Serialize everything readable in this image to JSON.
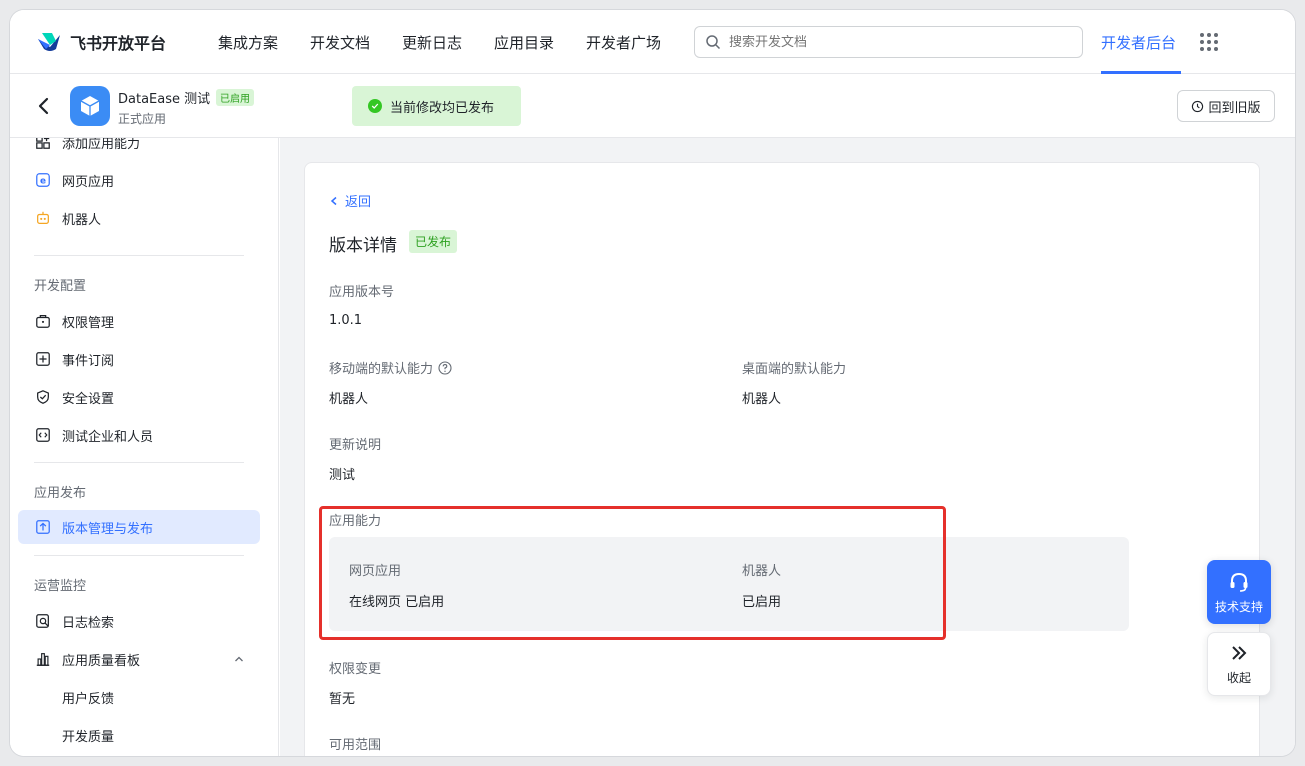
{
  "topnav": {
    "brand": "飞书开放平台",
    "links": [
      "集成方案",
      "开发文档",
      "更新日志",
      "应用目录",
      "开发者广场"
    ],
    "search_placeholder": "搜索开发文档",
    "console": "开发者后台"
  },
  "app": {
    "name": "DataEase 测试",
    "status_badge": "已启用",
    "type": "正式应用",
    "toast": "当前修改均已发布",
    "revert_button": "回到旧版"
  },
  "sidebar": {
    "top_items": [
      "添加应用能力",
      "网页应用",
      "机器人"
    ],
    "group_dev_config": "开发配置",
    "dev_items": [
      "权限管理",
      "事件订阅",
      "安全设置",
      "测试企业和人员"
    ],
    "group_publish": "应用发布",
    "publish_items": [
      "版本管理与发布"
    ],
    "group_ops": "运营监控",
    "ops_items": [
      "日志检索",
      "应用质量看板"
    ],
    "ops_sub_items": [
      "用户反馈",
      "开发质量"
    ]
  },
  "detail": {
    "back": "返回",
    "title": "版本详情",
    "badge": "已发布",
    "version_label": "应用版本号",
    "version_value": "1.0.1",
    "mobile_label": "移动端的默认能力",
    "mobile_value": "机器人",
    "desktop_label": "桌面端的默认能力",
    "desktop_value": "机器人",
    "notes_label": "更新说明",
    "notes_value": "测试",
    "capability_label": "应用能力",
    "cap_web_label": "网页应用",
    "cap_web_value": "在线网页 已启用",
    "cap_bot_label": "机器人",
    "cap_bot_value": "已启用",
    "perm_label": "权限变更",
    "perm_value": "暂无",
    "scope_label": "可用范围"
  },
  "floating": {
    "support": "技术支持",
    "collapse": "收起"
  },
  "colors": {
    "accent": "#3370ff",
    "success": "#34c724",
    "highlight": "#e5302b"
  }
}
